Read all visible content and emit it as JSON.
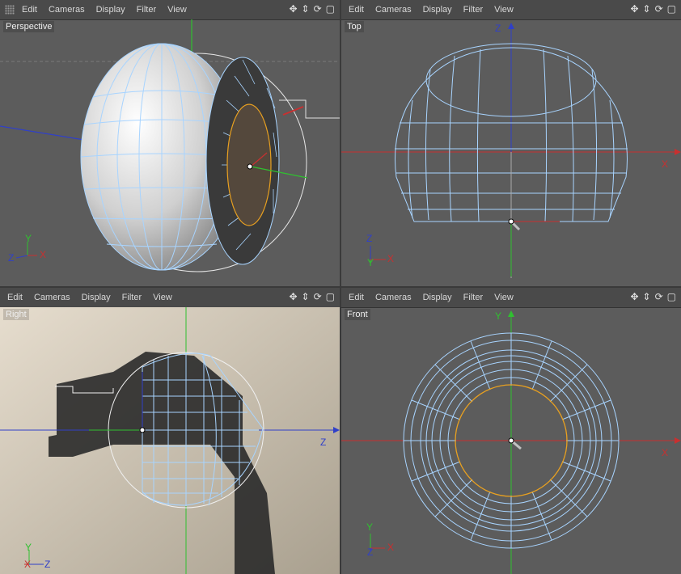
{
  "menu": [
    "Edit",
    "Cameras",
    "Display",
    "Filter",
    "View"
  ],
  "nav_icons": {
    "move": "✥",
    "zoom": "⇕",
    "rotate": "⟳",
    "maximize": "▢"
  },
  "viewports": {
    "perspective": {
      "label": "Perspective"
    },
    "top": {
      "label": "Top"
    },
    "right": {
      "label": "Right"
    },
    "front": {
      "label": "Front"
    }
  },
  "axes": {
    "x": "X",
    "y": "Y",
    "z": "Z"
  },
  "colors": {
    "wire": "#a8d4ff",
    "x_axis": "#c83030",
    "y_axis": "#30c030",
    "z_axis": "#3040c8",
    "selection": "#e8a020",
    "viewport_bg": "#5c5c5c"
  }
}
